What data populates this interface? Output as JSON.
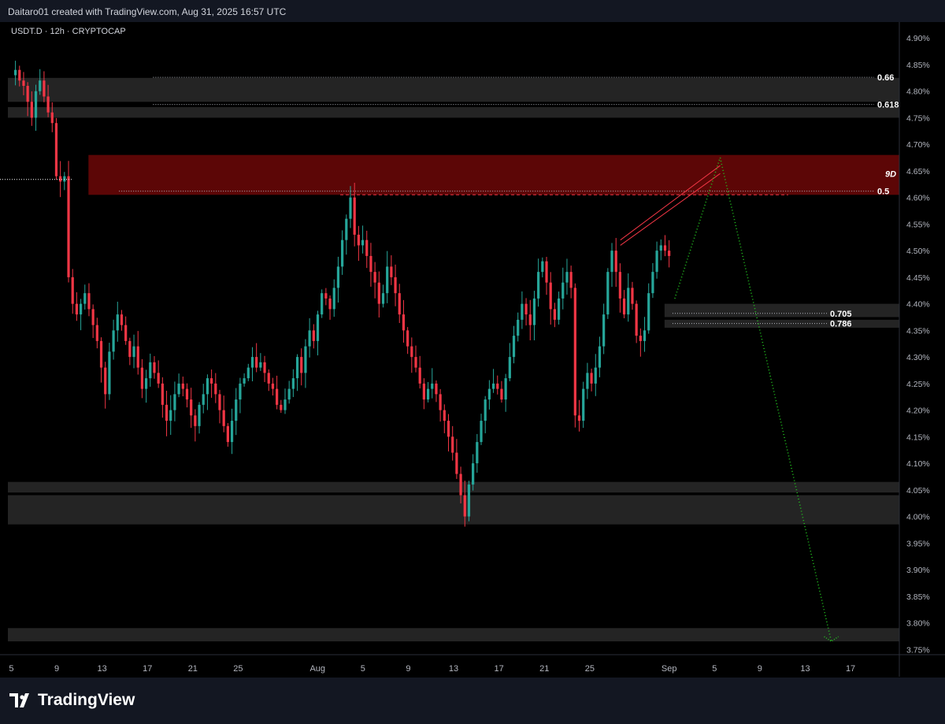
{
  "header": {
    "attribution": "Daitaro01 created with TradingView.com, Aug 31, 2025 16:57 UTC"
  },
  "symbol": {
    "label": "USDT.D · 12h · CRYPTOCAP"
  },
  "branding": {
    "name": "TradingView"
  },
  "chart_data": {
    "type": "candlestick",
    "y_axis": {
      "position": "right",
      "unit": "%",
      "range": [
        3.74,
        4.93
      ],
      "tick_labels": [
        "4.90%",
        "4.85%",
        "4.80%",
        "4.75%",
        "4.70%",
        "4.65%",
        "4.60%",
        "4.55%",
        "4.50%",
        "4.45%",
        "4.40%",
        "4.35%",
        "4.30%",
        "4.25%",
        "4.20%",
        "4.15%",
        "4.10%",
        "4.05%",
        "4.00%",
        "3.95%",
        "3.90%",
        "3.85%",
        "3.80%",
        "3.75%"
      ],
      "tick_values": [
        4.9,
        4.85,
        4.8,
        4.75,
        4.7,
        4.65,
        4.6,
        4.55,
        4.5,
        4.45,
        4.4,
        4.35,
        4.3,
        4.25,
        4.2,
        4.15,
        4.1,
        4.05,
        4.0,
        3.95,
        3.9,
        3.85,
        3.8,
        3.75
      ]
    },
    "x_axis": {
      "unit": "days from first visible bar",
      "range": [
        0,
        73
      ],
      "ticks": [
        {
          "label": "5",
          "day": 0
        },
        {
          "label": "9",
          "day": 4
        },
        {
          "label": "13",
          "day": 8
        },
        {
          "label": "17",
          "day": 12
        },
        {
          "label": "21",
          "day": 16
        },
        {
          "label": "25",
          "day": 20
        },
        {
          "label": "Aug",
          "day": 27
        },
        {
          "label": "5",
          "day": 31
        },
        {
          "label": "9",
          "day": 35
        },
        {
          "label": "13",
          "day": 39
        },
        {
          "label": "17",
          "day": 43
        },
        {
          "label": "21",
          "day": 47
        },
        {
          "label": "25",
          "day": 51
        },
        {
          "label": "Sep",
          "day": 58
        },
        {
          "label": "5",
          "day": 62
        },
        {
          "label": "9",
          "day": 66
        },
        {
          "label": "13",
          "day": 70
        },
        {
          "label": "17",
          "day": 74
        }
      ]
    },
    "colors": {
      "up": "#26a69a",
      "down": "#f23645",
      "zone_red": "#5c0606",
      "zone_grey": "#2a2a2a",
      "projection": "#22c51f",
      "level_line": "#b2b5be"
    },
    "candles_close": [
      4.83,
      4.84,
      4.82,
      4.81,
      4.78,
      4.75,
      4.8,
      4.82,
      4.79,
      4.76,
      4.74,
      4.64,
      4.63,
      4.64,
      4.45,
      4.4,
      4.38,
      4.4,
      4.42,
      4.39,
      4.36,
      4.33,
      4.28,
      4.23,
      4.31,
      4.35,
      4.38,
      4.36,
      4.33,
      4.3,
      4.32,
      4.28,
      4.24,
      4.26,
      4.29,
      4.27,
      4.25,
      4.21,
      4.18,
      4.2,
      4.23,
      4.25,
      4.24,
      4.22,
      4.19,
      4.17,
      4.21,
      4.23,
      4.26,
      4.25,
      4.23,
      4.2,
      4.17,
      4.14,
      4.18,
      4.22,
      4.25,
      4.26,
      4.28,
      4.3,
      4.28,
      4.29,
      4.27,
      4.25,
      4.24,
      4.21,
      4.2,
      4.22,
      4.24,
      4.26,
      4.3,
      4.27,
      4.32,
      4.35,
      4.33,
      4.38,
      4.42,
      4.41,
      4.39,
      4.43,
      4.47,
      4.52,
      4.56,
      4.6,
      4.53,
      4.51,
      4.52,
      4.49,
      4.46,
      4.44,
      4.4,
      4.42,
      4.47,
      4.45,
      4.42,
      4.38,
      4.35,
      4.32,
      4.3,
      4.28,
      4.25,
      4.22,
      4.24,
      4.25,
      4.23,
      4.2,
      4.18,
      4.15,
      4.12,
      4.08,
      4.04,
      4.0,
      4.06,
      4.1,
      4.14,
      4.18,
      4.22,
      4.24,
      4.25,
      4.24,
      4.22,
      4.26,
      4.3,
      4.34,
      4.37,
      4.4,
      4.38,
      4.36,
      4.41,
      4.46,
      4.48,
      4.44,
      4.39,
      4.37,
      4.41,
      4.44,
      4.46,
      4.43,
      4.19,
      4.18,
      4.24,
      4.27,
      4.25,
      4.28,
      4.32,
      4.38,
      4.46,
      4.5,
      4.46,
      4.41,
      4.38,
      4.43,
      4.4,
      4.34,
      4.33,
      4.35,
      4.42,
      4.46,
      4.5,
      4.51,
      4.5,
      4.49
    ],
    "zones": [
      {
        "from": 4.825,
        "to": 4.78,
        "color": "grey"
      },
      {
        "from": 4.77,
        "to": 4.75,
        "color": "grey"
      },
      {
        "from": 4.68,
        "to": 4.605,
        "color": "red"
      },
      {
        "from": 4.4,
        "to": 4.375,
        "color": "grey"
      },
      {
        "from": 4.37,
        "to": 4.355,
        "color": "grey"
      },
      {
        "from": 4.065,
        "to": 4.045,
        "color": "grey"
      },
      {
        "from": 4.04,
        "to": 3.985,
        "color": "grey"
      },
      {
        "from": 3.79,
        "to": 3.765,
        "color": "grey"
      }
    ],
    "levels": [
      {
        "label": "0.66",
        "value": 4.826
      },
      {
        "label": "0.618",
        "value": 4.775
      },
      {
        "label": "0.5",
        "value": 4.612
      },
      {
        "label": "0.705",
        "value": 4.382
      },
      {
        "label": "0.786",
        "value": 4.363
      }
    ],
    "annotations": [
      {
        "label": "9D",
        "value": 4.645
      }
    ],
    "projection_path": [
      {
        "day": 58.5,
        "value": 4.41
      },
      {
        "day": 62.5,
        "value": 4.675
      },
      {
        "day": 72.3,
        "value": 3.765
      }
    ]
  }
}
